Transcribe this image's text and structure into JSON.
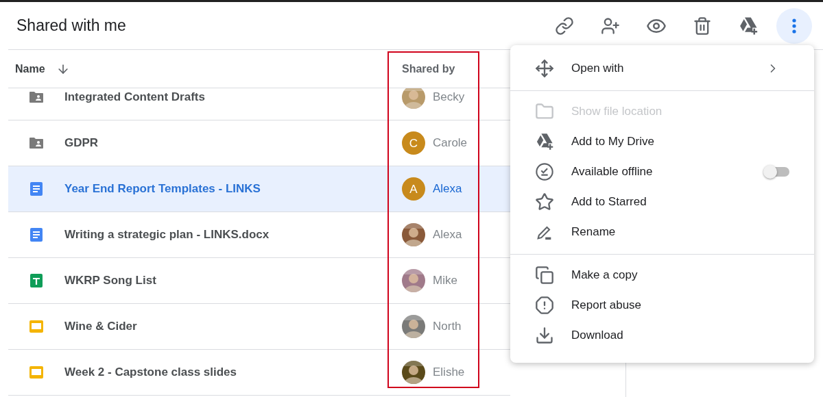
{
  "title": "Shared with me",
  "toolbar": [
    {
      "kind": "link",
      "selected": false
    },
    {
      "kind": "share",
      "selected": false
    },
    {
      "kind": "preview",
      "selected": false
    },
    {
      "kind": "trash",
      "selected": false
    },
    {
      "kind": "drive-add",
      "selected": false
    },
    {
      "kind": "more",
      "selected": true
    }
  ],
  "table": {
    "columns": [
      {
        "label": "Name",
        "sorted": true
      },
      {
        "label": "Shared by"
      }
    ],
    "rows": [
      {
        "kind": "shared-folder",
        "name": "Integrated Content Drafts",
        "shared_by": "Becky",
        "selected": false
      },
      {
        "kind": "shared-folder",
        "name": "GDPR",
        "shared_by": "Carole",
        "avatar": {
          "kind": "letter",
          "letter": "C",
          "color": "#c88a1c"
        },
        "selected": false
      },
      {
        "kind": "doc",
        "name": "Year End Report Templates - LINKS",
        "shared_by": "Alexa",
        "avatar": {
          "kind": "letter",
          "letter": "A",
          "color": "#c88a1c"
        },
        "selected": true
      },
      {
        "kind": "doc",
        "name": "Writing a strategic plan - LINKS.docx",
        "shared_by": "Alexa",
        "selected": false
      },
      {
        "kind": "sheet",
        "name": "WKRP Song List",
        "shared_by": "Mike",
        "selected": false
      },
      {
        "kind": "slides",
        "name": "Wine & Cider",
        "shared_by": "North",
        "selected": false
      },
      {
        "kind": "slides",
        "name": "Week 2 - Capstone class slides",
        "shared_by": "Elishe",
        "selected": false
      }
    ]
  },
  "menu": {
    "sections": [
      [
        {
          "kind": "move",
          "label": "Open with",
          "submenu": true,
          "disabled": false
        }
      ],
      [
        {
          "kind": "folder",
          "label": "Show file location",
          "disabled": true
        },
        {
          "kind": "drive-add",
          "label": "Add to My Drive",
          "disabled": false
        },
        {
          "kind": "offline",
          "label": "Available offline",
          "disabled": false,
          "toggle": {
            "on": false
          }
        },
        {
          "kind": "star",
          "label": "Add to Starred",
          "disabled": false
        },
        {
          "kind": "rename",
          "label": "Rename",
          "disabled": false
        }
      ],
      [
        {
          "kind": "copy",
          "label": "Make a copy",
          "disabled": false
        },
        {
          "kind": "report",
          "label": "Report abuse",
          "disabled": false
        },
        {
          "kind": "download",
          "label": "Download",
          "disabled": false
        }
      ]
    ]
  }
}
